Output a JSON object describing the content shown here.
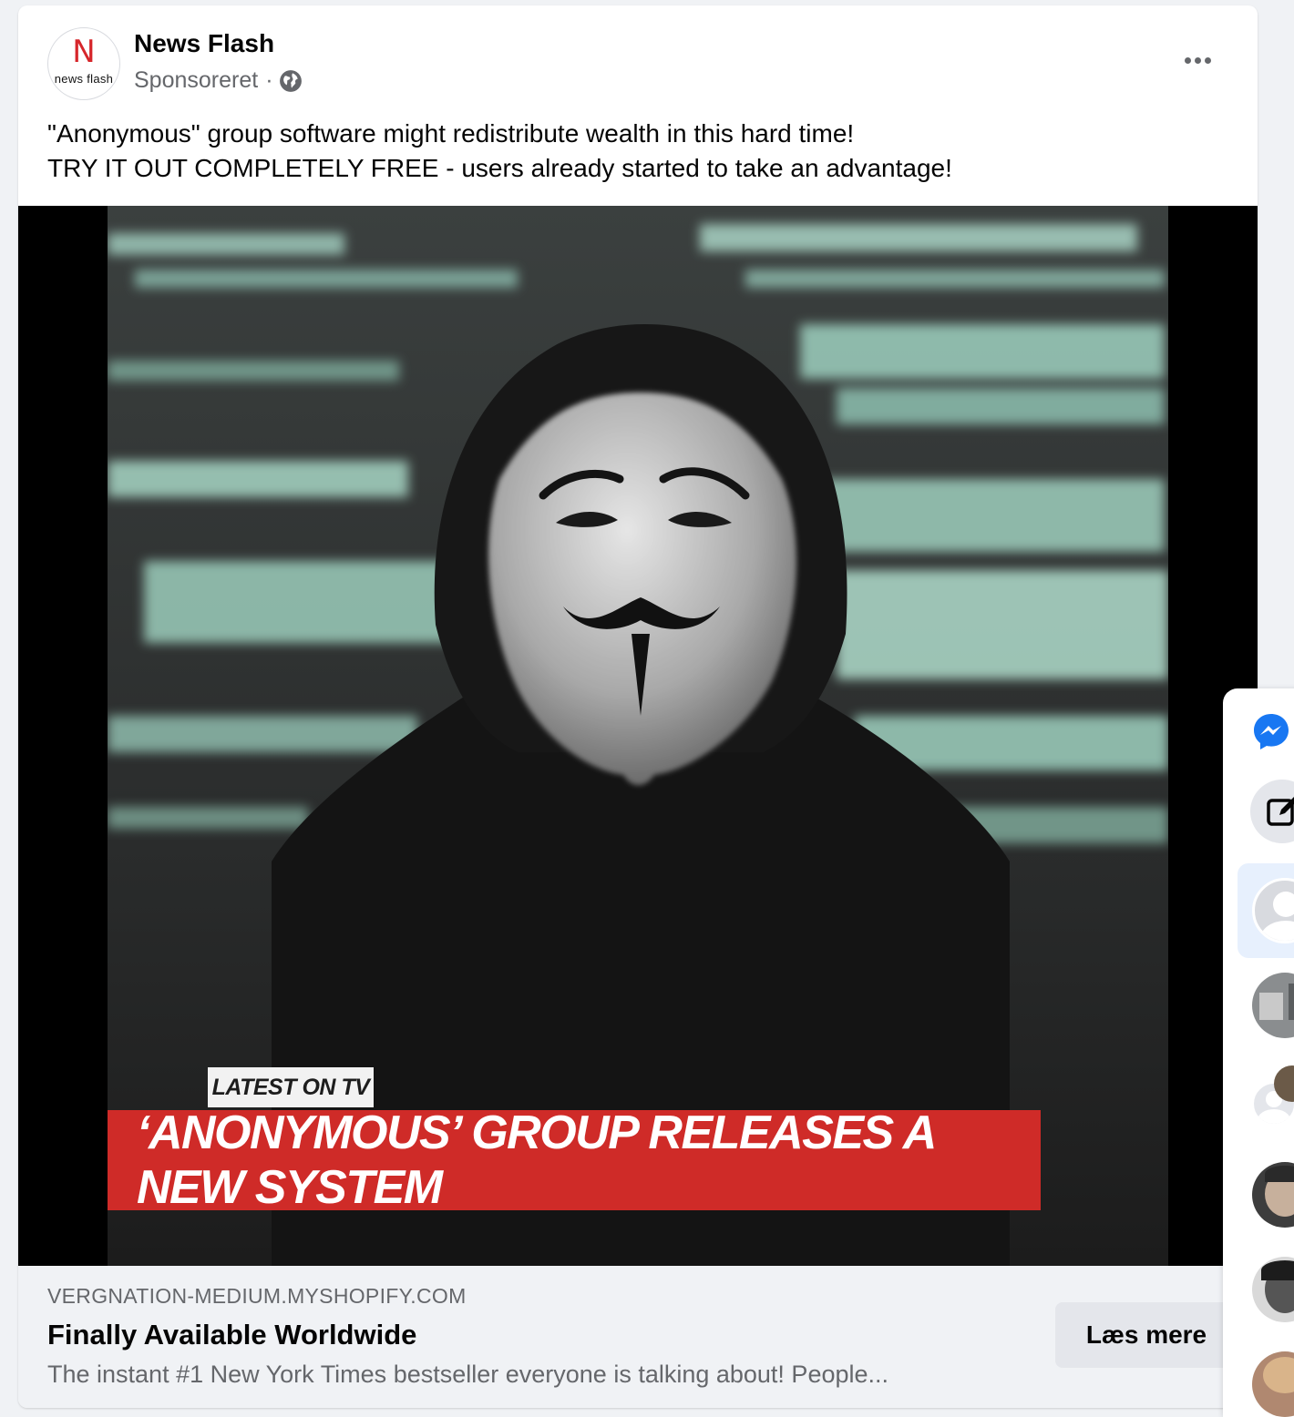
{
  "post": {
    "page_name": "News Flash",
    "sponsored_label": "Sponsoreret",
    "separator": "·",
    "logo": {
      "letter": "N",
      "text": "news flash"
    },
    "text_lines": [
      "\"Anonymous\" group software might redistribute wealth in this hard time!",
      "TRY IT OUT COMPLETELY FREE - users already started to take an advantage!"
    ],
    "image": {
      "tag": "LATEST ON TV",
      "banner": "‘ANONYMOUS’ GROUP RELEASES A NEW SYSTEM"
    },
    "link": {
      "domain": "VERGNATION-MEDIUM.MYSHOPIFY.COM",
      "headline": "Finally Available Worldwide",
      "description": "The instant #1 New York Times bestseller everyone is talking about! People...",
      "cta": "Læs mere"
    }
  },
  "icons": {
    "audience": "globe-icon",
    "menu": "more-options-icon",
    "messenger": "messenger-icon",
    "compose": "compose-icon"
  },
  "colors": {
    "brand_red": "#d6262b",
    "banner_red": "#cf2b28",
    "messenger_blue": "#1877f2",
    "card_bg": "#f0f2f5"
  }
}
